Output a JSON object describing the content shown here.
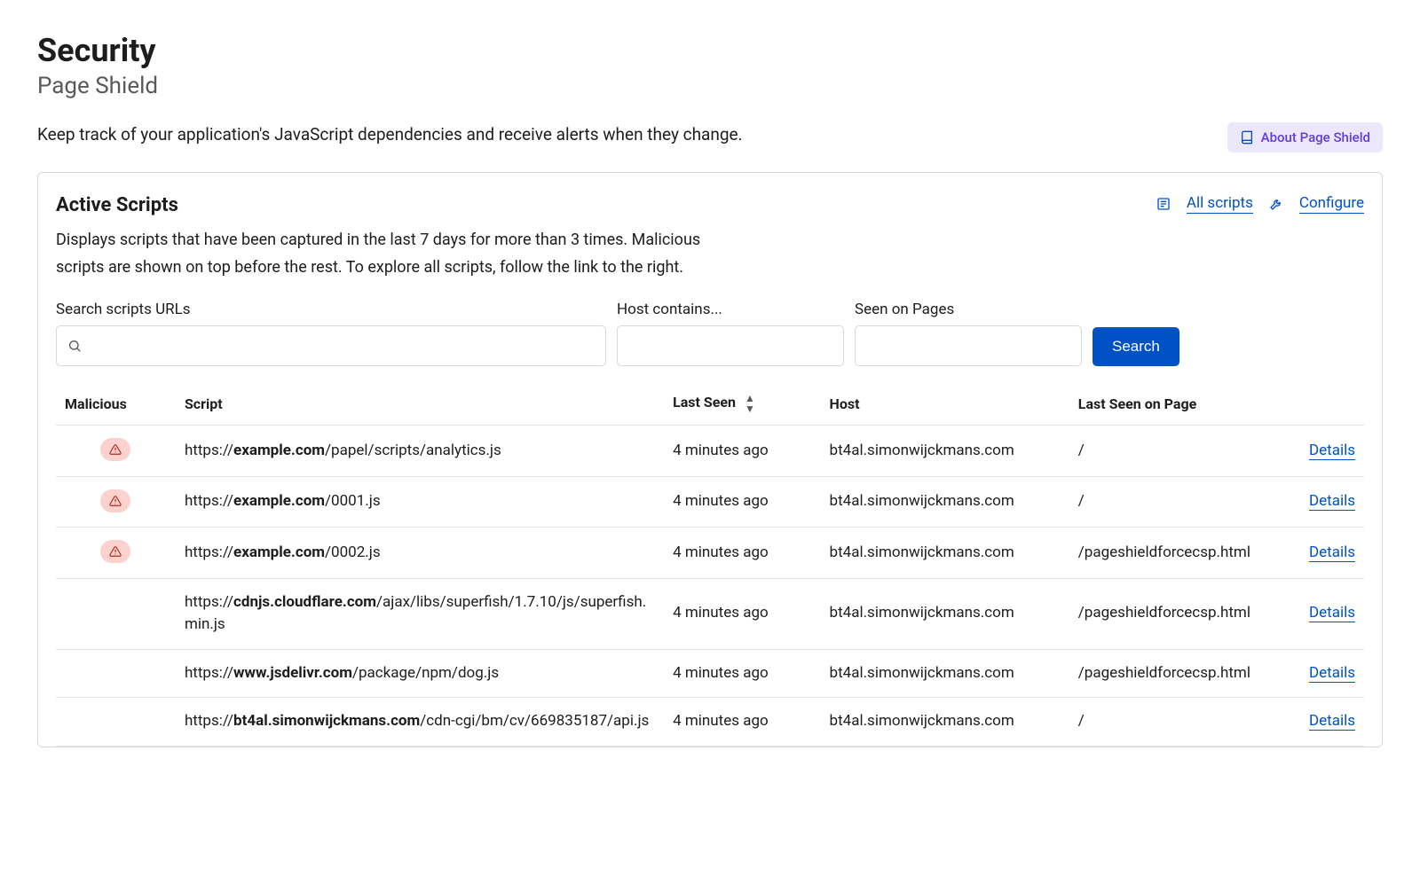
{
  "page": {
    "title": "Security",
    "subtitle": "Page Shield",
    "intro": "Keep track of your application's JavaScript dependencies and receive alerts when they change.",
    "about_chip": "About Page Shield"
  },
  "card": {
    "title": "Active Scripts",
    "description": "Displays scripts that have been captured in the last 7 days for more than 3 times. Malicious scripts are shown on top before the rest. To explore all scripts, follow the link to the right.",
    "all_scripts_label": "All scripts",
    "configure_label": "Configure"
  },
  "filters": {
    "search_label": "Search scripts URLs",
    "host_label": "Host contains...",
    "seen_label": "Seen on Pages",
    "search_button": "Search"
  },
  "table": {
    "columns": {
      "malicious": "Malicious",
      "script": "Script",
      "last_seen": "Last Seen",
      "host": "Host",
      "last_seen_page": "Last Seen on Page"
    },
    "details_label": "Details",
    "rows": [
      {
        "malicious": true,
        "script_prefix": "https://",
        "script_host": "example.com",
        "script_path": "/papel/scripts/analytics.js",
        "last_seen": "4 minutes ago",
        "host": "bt4al.simonwijckmans.com",
        "page": "/"
      },
      {
        "malicious": true,
        "script_prefix": "https://",
        "script_host": "example.com",
        "script_path": "/0001.js",
        "last_seen": "4 minutes ago",
        "host": "bt4al.simonwijckmans.com",
        "page": "/"
      },
      {
        "malicious": true,
        "script_prefix": "https://",
        "script_host": "example.com",
        "script_path": "/0002.js",
        "last_seen": "4 minutes ago",
        "host": "bt4al.simonwijckmans.com",
        "page": "/pageshieldforcecsp.html"
      },
      {
        "malicious": false,
        "script_prefix": "https://",
        "script_host": "cdnjs.cloudflare.com",
        "script_path": "/ajax/libs/superfish/1.7.10/js/superfish.min.js",
        "last_seen": "4 minutes ago",
        "host": "bt4al.simonwijckmans.com",
        "page": "/pageshieldforcecsp.html"
      },
      {
        "malicious": false,
        "script_prefix": "https://",
        "script_host": "www.jsdelivr.com",
        "script_path": "/package/npm/dog.js",
        "last_seen": "4 minutes ago",
        "host": "bt4al.simonwijckmans.com",
        "page": "/pageshieldforcecsp.html"
      },
      {
        "malicious": false,
        "script_prefix": "https://",
        "script_host": "bt4al.simonwijckmans.com",
        "script_path": "/cdn-cgi/bm/cv/669835187/api.js",
        "last_seen": "4 minutes ago",
        "host": "bt4al.simonwijckmans.com",
        "page": "/"
      }
    ]
  }
}
